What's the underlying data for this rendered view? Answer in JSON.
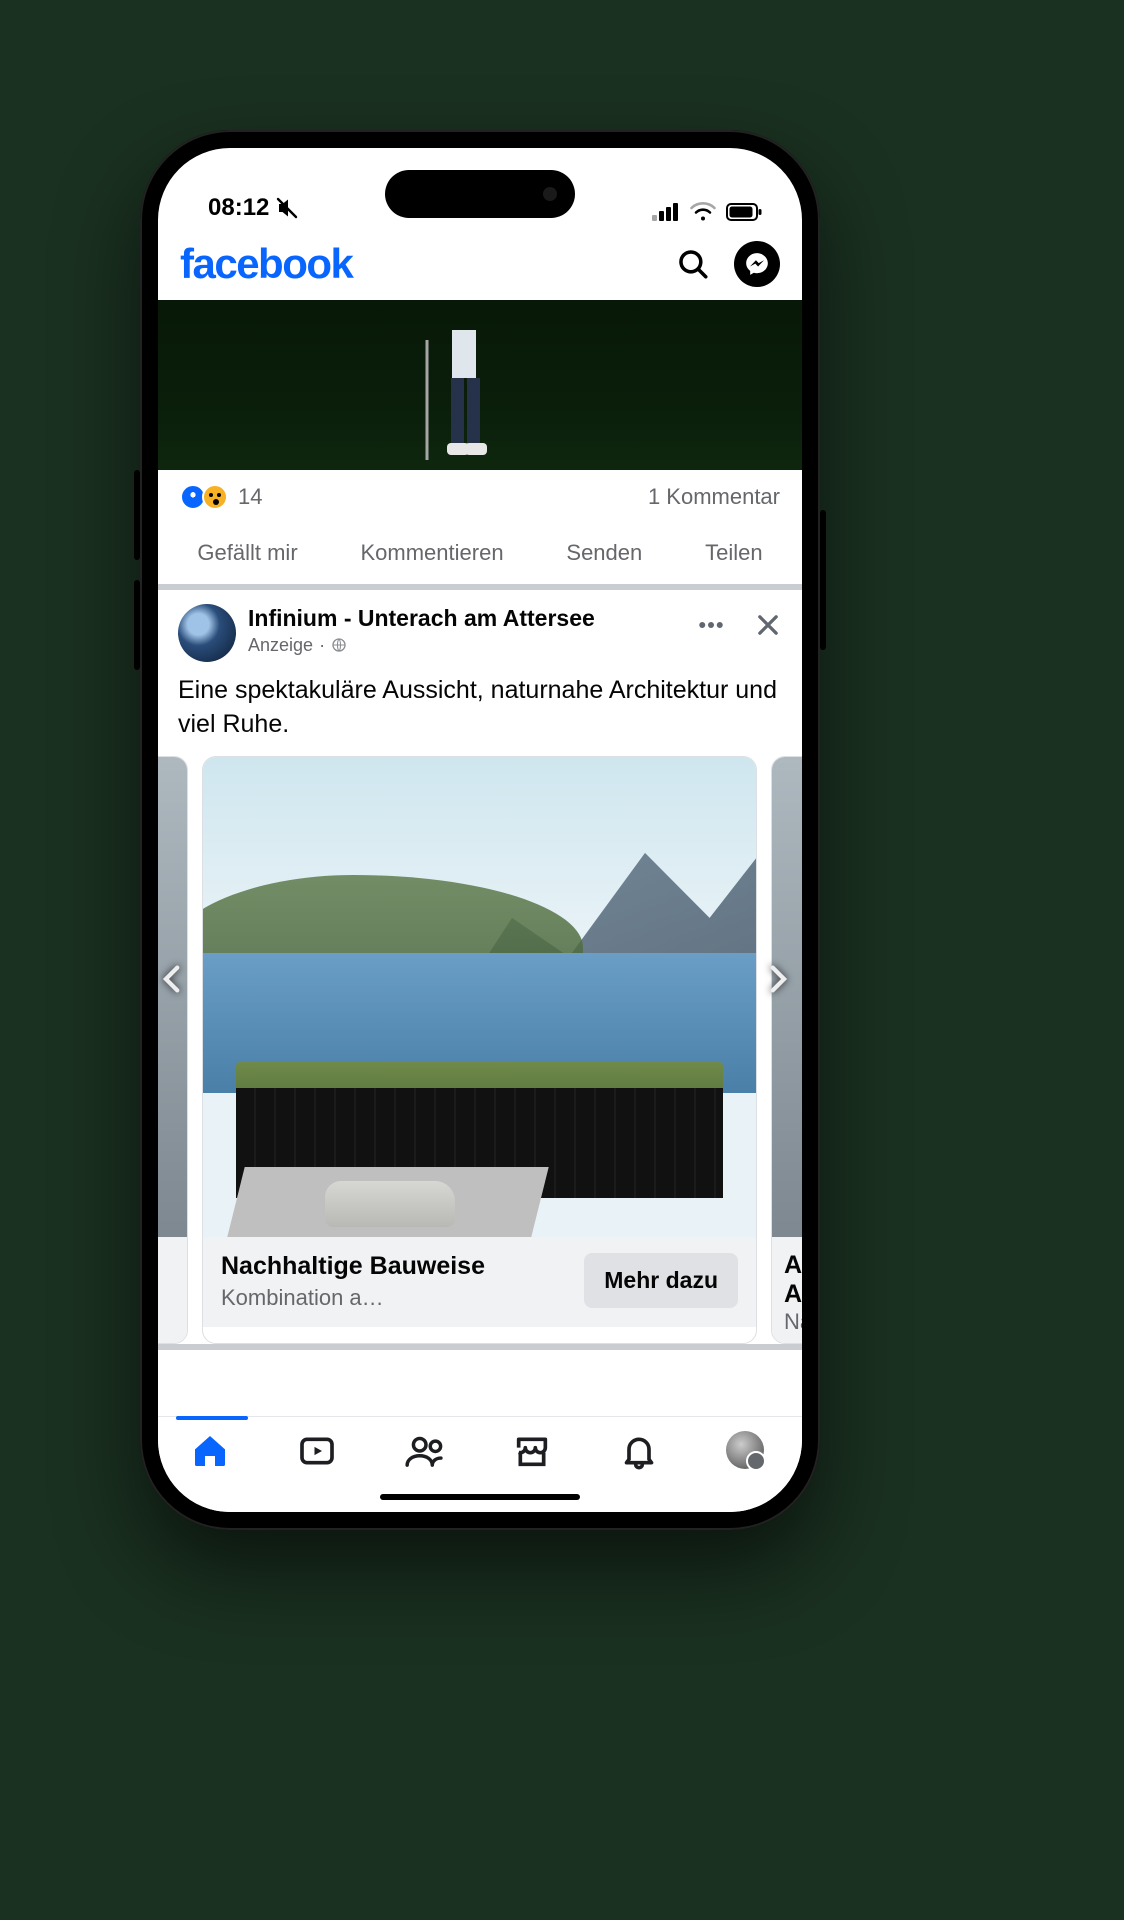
{
  "status": {
    "time": "08:12"
  },
  "header": {
    "logo_text": "facebook"
  },
  "post1": {
    "reaction_count": "14",
    "comments_label": "1 Kommentar",
    "actions": {
      "like": "Gefällt mir",
      "comment": "Kommentieren",
      "send": "Senden",
      "share": "Teilen"
    }
  },
  "post2": {
    "page_name": "Infinium - Unterach am Attersee",
    "sponsored_label": "Anzeige",
    "copy": "Eine spektakuläre Aussicht, naturnahe Architektur und viel Ruhe.",
    "card": {
      "title": "Nachhaltige Bauweise",
      "subtitle": "Kombination a…",
      "cta": "Mehr dazu"
    },
    "peek_right": {
      "title_frag": "Ans",
      "line2_frag": "Arc",
      "line3_frag": "Nat"
    }
  }
}
